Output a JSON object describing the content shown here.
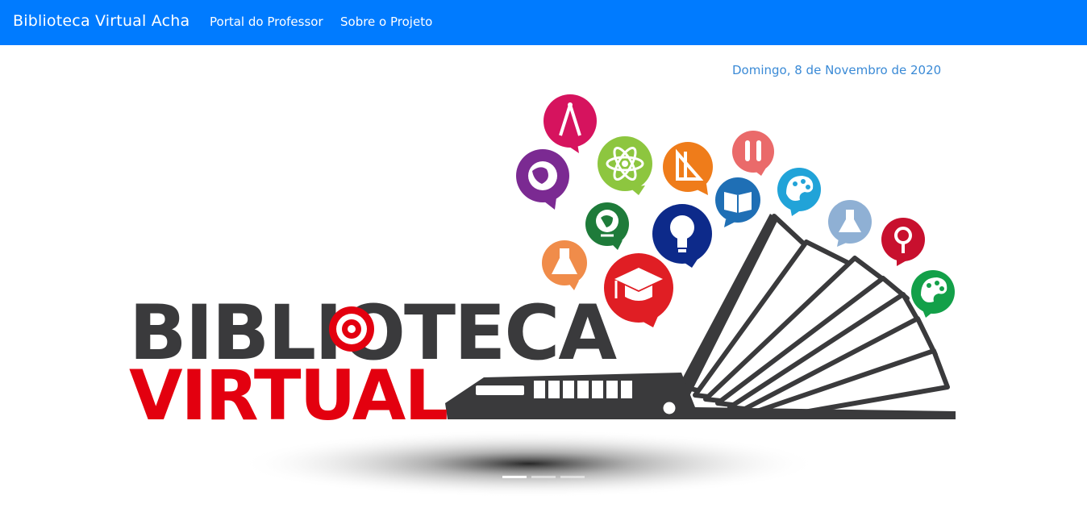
{
  "navbar": {
    "brand": "Biblioteca Virtual Acha",
    "links": [
      {
        "label": "Portal do Professor"
      },
      {
        "label": "Sobre o Projeto"
      }
    ],
    "color": "#007bff"
  },
  "date_text": "Domingo, 8 de Novembro de 2020",
  "carousel": {
    "logo_line1": "BIBLIOTECA",
    "logo_line2": "VIRTUAL",
    "slide_count": 3,
    "active_slide": 1,
    "colors": {
      "dark": "#3a3a3c",
      "red": "#e3000f"
    },
    "bubbles": [
      {
        "icon": "compass-icon",
        "color": "#d6135e"
      },
      {
        "icon": "globe-icon",
        "color": "#7b2a92"
      },
      {
        "icon": "atom-icon",
        "color": "#8dc63f"
      },
      {
        "icon": "geometry-icon",
        "color": "#ef7c1a"
      },
      {
        "icon": "pencils-icon",
        "color": "#ea6a6a"
      },
      {
        "icon": "book-icon",
        "color": "#1f6fb5"
      },
      {
        "icon": "palette-icon",
        "color": "#21a3d8"
      },
      {
        "icon": "earth-globe-icon",
        "color": "#1e7b3a"
      },
      {
        "icon": "lightbulb-icon",
        "color": "#0d2a8a"
      },
      {
        "icon": "flask-icon",
        "color": "#8fb0d4"
      },
      {
        "icon": "magnifier-icon",
        "color": "#c8102e"
      },
      {
        "icon": "potion-icon",
        "color": "#f08c4a"
      },
      {
        "icon": "graduation-cap-icon",
        "color": "#e01e24"
      },
      {
        "icon": "palette-icon",
        "color": "#13a049"
      }
    ]
  }
}
